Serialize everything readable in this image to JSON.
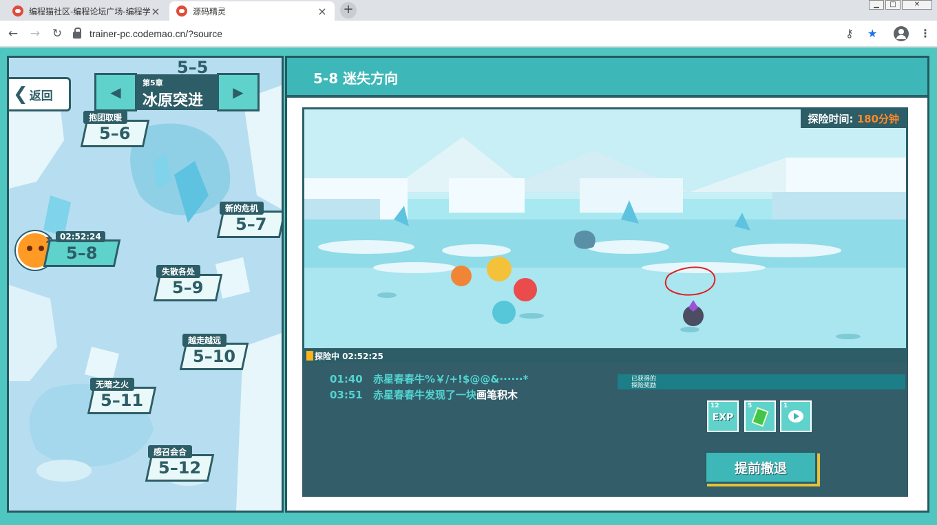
{
  "browser": {
    "tabs": [
      {
        "title": "编程猫社区-编程论坛广场-编程学",
        "active": false
      },
      {
        "title": "源码精灵",
        "active": true
      }
    ],
    "url": "trainer-pc.codemao.cn/?source",
    "window_controls": [
      "minimize",
      "maximize",
      "close"
    ]
  },
  "map": {
    "back_label": "返回",
    "chapter_num": "第5章",
    "chapter_name": "冰原突进",
    "top_node": "5–5",
    "timer": "02:52:24",
    "levels": [
      {
        "name": "抱团取暖",
        "num": "5–6"
      },
      {
        "name": "新的危机",
        "num": "5–7"
      },
      {
        "name": "",
        "num": "5–8",
        "current": true
      },
      {
        "name": "失散各处",
        "num": "5–9"
      },
      {
        "name": "越走越远",
        "num": "5–10"
      },
      {
        "name": "无暗之火",
        "num": "5–11"
      },
      {
        "name": "感召会合",
        "num": "5–12"
      }
    ]
  },
  "panel": {
    "title": "5-8 迷失方向",
    "explore_time_label": "探险时间:",
    "explore_time_value": "180分钟",
    "status": "探险中 02:52:25",
    "log": [
      {
        "time": "01:40",
        "text": "赤星春春牛%￥/+!$@@&······*",
        "item": ""
      },
      {
        "time": "03:51",
        "text": "赤星春春牛发现了一块",
        "item": "画笔积木"
      }
    ],
    "reward_title_1": "已获得的",
    "reward_title_2": "探险奖励",
    "rewards": [
      {
        "count": "12",
        "label": "EXP",
        "icon": "exp-icon"
      },
      {
        "count": "5",
        "label": "",
        "icon": "gem-icon"
      },
      {
        "count": "1",
        "label": "",
        "icon": "book-icon"
      }
    ],
    "retreat_label": "提前撤退"
  },
  "colors": {
    "frame": "#4fc7c0",
    "dark": "#2d5d66",
    "accent": "#ff8a2a",
    "teal": "#3db7b7"
  }
}
